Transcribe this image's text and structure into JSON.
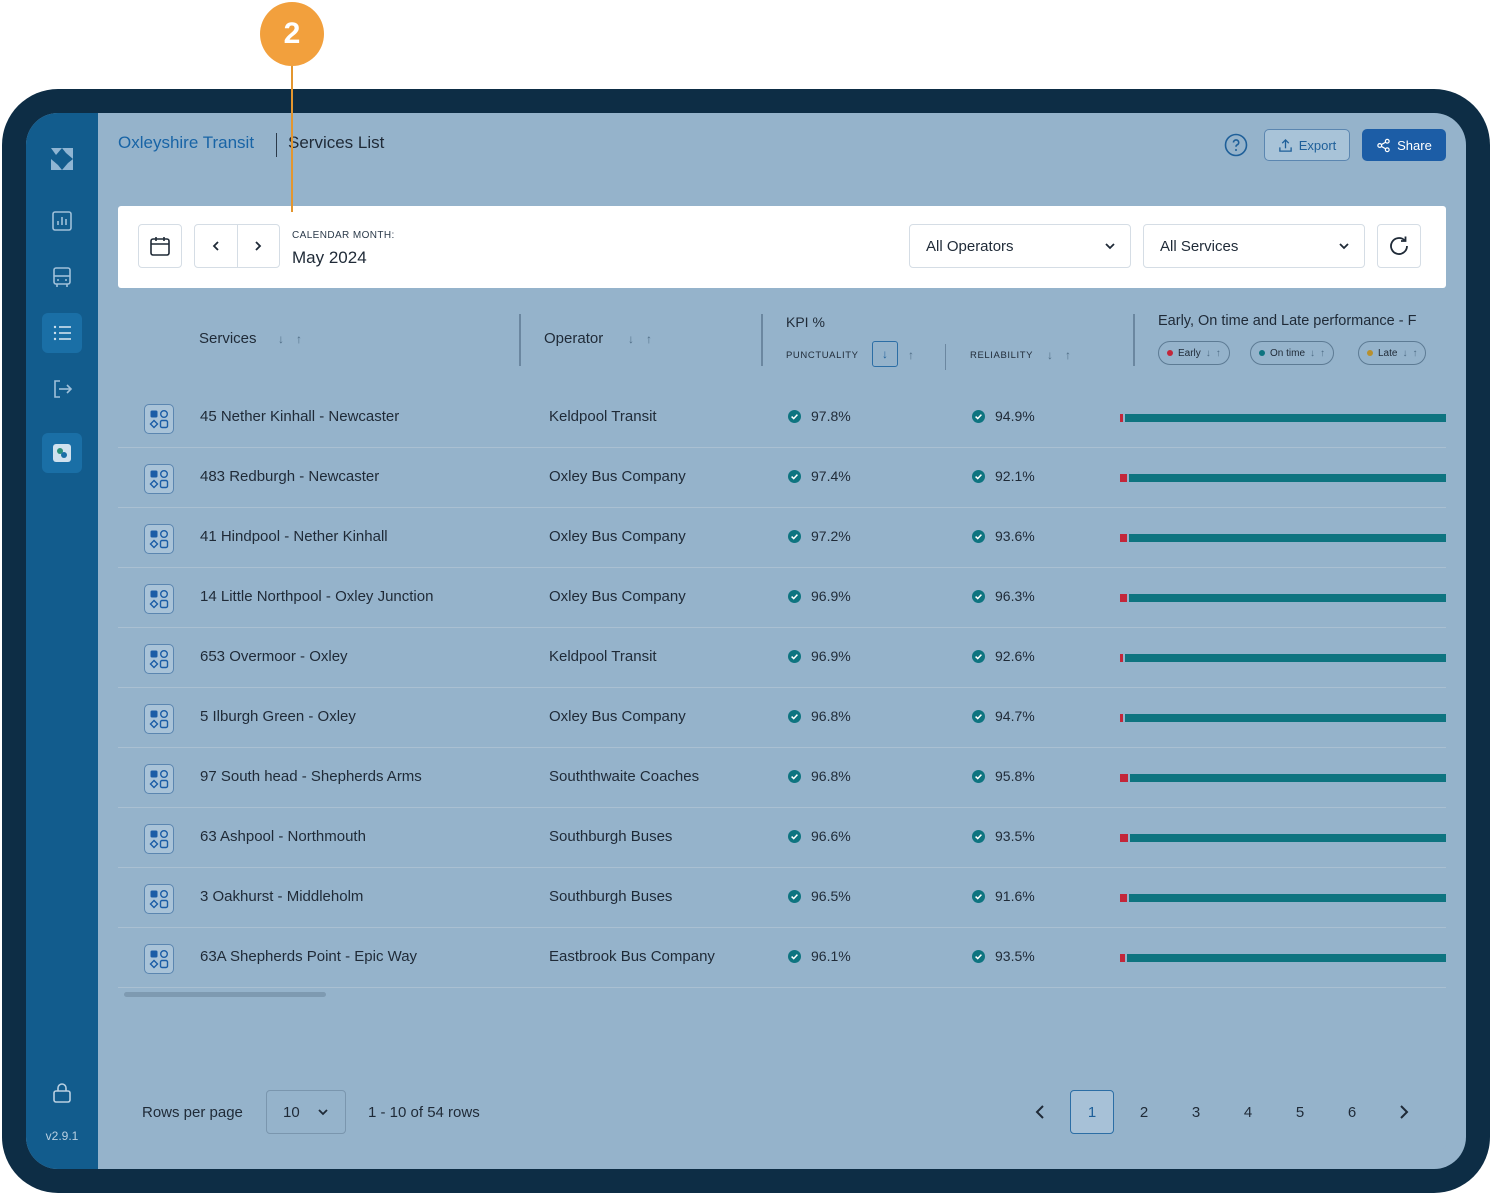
{
  "callout": {
    "number": "2",
    "color": "#f2a03d"
  },
  "app": {
    "version": "v2.9.1"
  },
  "sidebar": {
    "items": [
      {
        "icon": "chart-icon",
        "active": false
      },
      {
        "icon": "bus-icon",
        "active": false
      },
      {
        "icon": "list-icon",
        "active": true
      },
      {
        "icon": "exit-icon",
        "active": false
      },
      {
        "icon": "app-tile-icon",
        "active": false
      }
    ]
  },
  "header": {
    "org": "Oxleyshire Transit",
    "page": "Services List",
    "export_label": "Export",
    "share_label": "Share"
  },
  "filters": {
    "month_label": "CALENDAR MONTH:",
    "month_value": "May 2024",
    "operators": "All Operators",
    "services": "All Services"
  },
  "table": {
    "headers": {
      "services": "Services",
      "operator": "Operator",
      "kpi": "KPI %",
      "punctuality": "PUNCTUALITY",
      "reliability": "RELIABILITY",
      "performance": "Early, On time and Late performance - F",
      "chip_early": "Early",
      "chip_ontime": "On time",
      "chip_late": "Late"
    },
    "rows": [
      {
        "service": "45 Nether Kinhall - Newcaster",
        "operator": "Keldpool Transit",
        "punctuality": "97.8%",
        "reliability": "94.9%",
        "early": 0.01
      },
      {
        "service": "483 Redburgh - Newcaster",
        "operator": "Oxley Bus Company",
        "punctuality": "97.4%",
        "reliability": "92.1%",
        "early": 0.02
      },
      {
        "service": "41 Hindpool - Nether Kinhall",
        "operator": "Oxley Bus Company",
        "punctuality": "97.2%",
        "reliability": "93.6%",
        "early": 0.02
      },
      {
        "service": "14 Little Northpool - Oxley Junction",
        "operator": "Oxley Bus Company",
        "punctuality": "96.9%",
        "reliability": "96.3%",
        "early": 0.02
      },
      {
        "service": "653 Overmoor - Oxley",
        "operator": "Keldpool Transit",
        "punctuality": "96.9%",
        "reliability": "92.6%",
        "early": 0.01
      },
      {
        "service": "5 Ilburgh Green - Oxley",
        "operator": "Oxley Bus Company",
        "punctuality": "96.8%",
        "reliability": "94.7%",
        "early": 0.01
      },
      {
        "service": "97 South head - Shepherds Arms",
        "operator": "Souththwaite Coaches",
        "punctuality": "96.8%",
        "reliability": "95.8%",
        "early": 0.025
      },
      {
        "service": "63 Ashpool - Northmouth",
        "operator": "Southburgh Buses",
        "punctuality": "96.6%",
        "reliability": "93.5%",
        "early": 0.025
      },
      {
        "service": "3 Oakhurst - Middleholm",
        "operator": "Southburgh Buses",
        "punctuality": "96.5%",
        "reliability": "91.6%",
        "early": 0.02
      },
      {
        "service": "63A Shepherds Point - Epic Way",
        "operator": "Eastbrook Bus Company",
        "punctuality": "96.1%",
        "reliability": "93.5%",
        "early": 0.015
      }
    ]
  },
  "footer": {
    "rows_per_page_label": "Rows per page",
    "rows_per_page_value": "10",
    "rows_info": "1 - 10 of 54 rows",
    "pages": [
      "1",
      "2",
      "3",
      "4",
      "5",
      "6"
    ],
    "current_page": "1"
  },
  "colors": {
    "early": "#c3263a",
    "on_time": "#0e7480",
    "late": "#b8902e",
    "sidebar": "#125c8d",
    "accent": "#1c5da6"
  }
}
